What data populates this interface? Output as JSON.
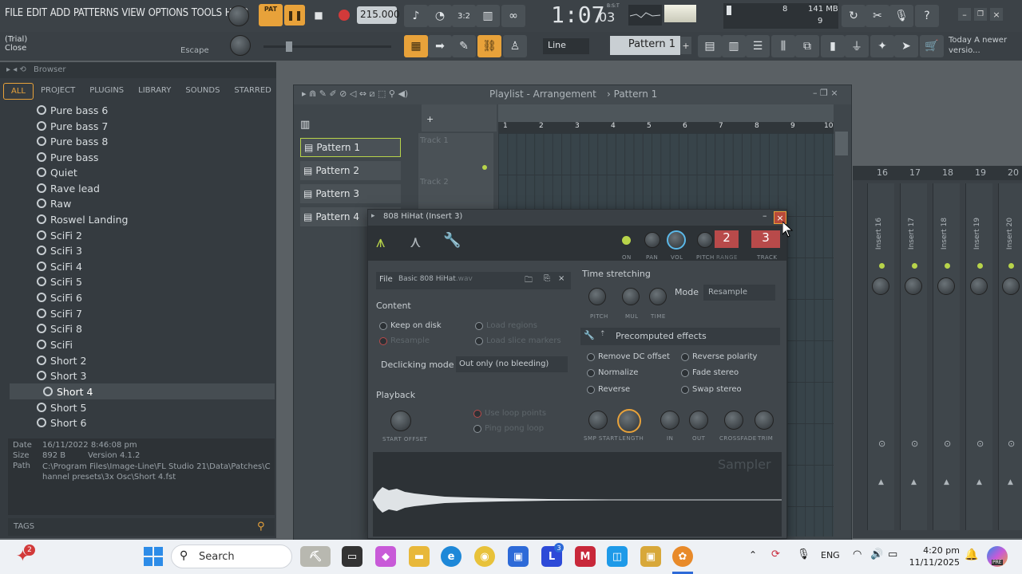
{
  "menu": [
    "FILE",
    "EDIT",
    "ADD",
    "PATTERNS",
    "VIEW",
    "OPTIONS",
    "TOOLS",
    "HELP"
  ],
  "transport": {
    "mode": "PAT",
    "tempo": "215.000",
    "time": "1:07",
    "time_sub": "03",
    "time_label": "B:S:T"
  },
  "system": {
    "cpu": "8",
    "mem": "141 MB",
    "voices": "9"
  },
  "hint": {
    "line1": "(Trial)",
    "line2": "Close",
    "shortcut": "Escape"
  },
  "toolbar": {
    "snap": "Line",
    "pattern": "Pattern 1",
    "news_title": "Today",
    "news_text": "A newer versio..."
  },
  "browser": {
    "title": "Browser",
    "tabs": [
      "ALL",
      "PROJECT",
      "PLUGINS",
      "LIBRARY",
      "SOUNDS",
      "STARRED"
    ],
    "items": [
      "Pure bass 6",
      "Pure bass 7",
      "Pure bass 8",
      "Pure bass",
      "Quiet",
      "Rave lead",
      "Raw",
      "Roswel Landing",
      "SciFi 2",
      "SciFi 3",
      "SciFi 4",
      "SciFi 5",
      "SciFi 6",
      "SciFi 7",
      "SciFi 8",
      "SciFi",
      "Short 2",
      "Short 3",
      "Short 4",
      "Short 5",
      "Short 6"
    ],
    "info": {
      "date_label": "Date",
      "date": "16/11/2022 8:46:08 pm",
      "size_label": "Size",
      "size": "892 B",
      "version": "Version 4.1.2",
      "path_label": "Path",
      "path": "C:\\Program Files\\Image-Line\\FL Studio 21\\Data\\Patches\\Channel presets\\3x Osc\\Short 4.fst"
    },
    "tags_label": "TAGS"
  },
  "playlist": {
    "title": "Playlist - Arrangement",
    "pattern": "Pattern 1",
    "patterns": [
      "Pattern 1",
      "Pattern 2",
      "Pattern 3",
      "Pattern 4"
    ],
    "tracks": [
      "Track 1",
      "Track 2"
    ],
    "bars": [
      "1",
      "2",
      "3",
      "4",
      "5",
      "6",
      "7",
      "8",
      "9",
      "10"
    ]
  },
  "mixer": {
    "inserts": [
      "Insert 16",
      "Insert 17",
      "Insert 18",
      "Insert 19",
      "Insert 20"
    ],
    "numbers": [
      "16",
      "17",
      "18",
      "19",
      "20"
    ]
  },
  "sampler": {
    "title": "808 HiHat (Insert 3)",
    "knobs": [
      "ON",
      "PAN",
      "VOL",
      "PITCH"
    ],
    "range_value": "2",
    "range_label": "RANGE",
    "track_value": "3",
    "track_label": "TRACK",
    "file_label": "File",
    "file_name": "Basic 808 HiHat",
    "file_ext": ".wav",
    "content_title": "Content",
    "keep_on_disk": "Keep on disk",
    "load_regions": "Load regions",
    "resample": "Resample",
    "load_slice": "Load slice markers",
    "declick_label": "Declicking mode",
    "declick_value": "Out only (no bleeding)",
    "playback_title": "Playback",
    "start_offset": "START OFFSET",
    "use_loop": "Use loop points",
    "ping_pong": "Ping pong loop",
    "ts_title": "Time stretching",
    "ts_knobs": [
      "PITCH",
      "MUL",
      "TIME"
    ],
    "mode_label": "Mode",
    "mode_value": "Resample",
    "pe_title": "Precomputed effects",
    "effects": [
      "Remove DC offset",
      "Reverse polarity",
      "Normalize",
      "Fade stereo",
      "Reverse",
      "Swap stereo"
    ],
    "env_knobs": [
      "SMP START",
      "LENGTH",
      "IN",
      "OUT",
      "CROSSFADE",
      "TRIM"
    ],
    "watermark": "Sampler"
  },
  "taskbar": {
    "search": "Search",
    "lang": "ENG",
    "time": "4:20 pm",
    "date": "11/11/2025",
    "badge": "2",
    "l_badge": "3",
    "copilot": "PRE"
  }
}
